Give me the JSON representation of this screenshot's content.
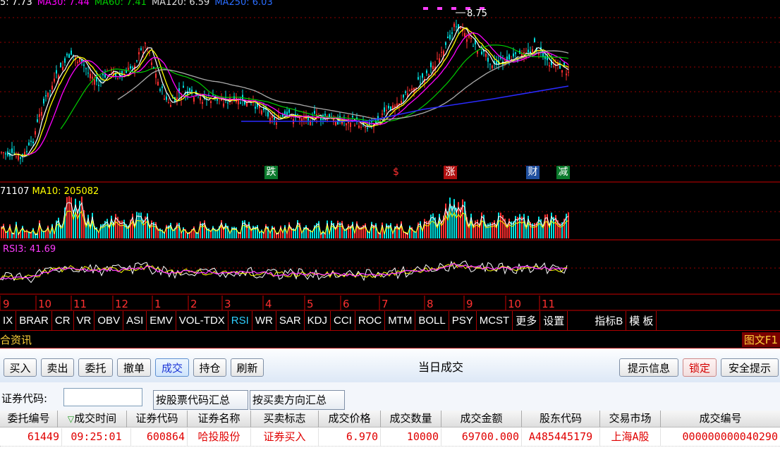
{
  "colors": {
    "ma5": "#ffffff",
    "ma10": "#ffff00",
    "ma20": "#ff00ff",
    "ma60": "#00cc00",
    "ma120": "#aaaaaa",
    "ma250": "#2a2aff",
    "up": "#ff3030",
    "down": "#00e0e0",
    "grid": "#990000"
  },
  "price_panel": {
    "ma_legend": [
      {
        "text": "5: 7.73",
        "color": "#ffffff"
      },
      {
        "text": "MA30: 7.44",
        "color": "#ff00ff"
      },
      {
        "text": "MA60: 7.41",
        "color": "#00cc00"
      },
      {
        "text": "MA120: 6.59",
        "color": "#dddddd"
      },
      {
        "text": "MA250: 6.03",
        "color": "#2a6dff"
      }
    ],
    "high_label": "8.75",
    "markers": [
      {
        "text": "跌",
        "bg": "#0b7a2c"
      },
      {
        "text": "$",
        "bg": "#000000"
      },
      {
        "text": "涨",
        "bg": "#b01010"
      },
      {
        "text": "财",
        "bg": "#1f4f9e"
      },
      {
        "text": "减",
        "bg": "#0b7a2c"
      }
    ]
  },
  "volume_panel": {
    "legend_a": "71107",
    "legend_b": "MA10: 205082"
  },
  "rsi_panel": {
    "legend": "RSI3: 41.69"
  },
  "months": [
    "9",
    "10",
    "11",
    "12",
    "1",
    "2",
    "3",
    "4",
    "5",
    "6",
    "7",
    "8",
    "9",
    "10",
    "11"
  ],
  "indicator_tabs": [
    "IX",
    "BRAR",
    "CR",
    "VR",
    "OBV",
    "ASI",
    "EMV",
    "VOL-TDX",
    "RSI",
    "WR",
    "SAR",
    "KDJ",
    "CCI",
    "ROC",
    "MTM",
    "BOLL",
    "PSY",
    "MCST",
    "更多",
    "设置",
    "指标B",
    "模 板"
  ],
  "active_indicator": "RSI",
  "info_bar": {
    "left": "合资讯",
    "right": "图文F1"
  },
  "toolbar": {
    "buttons": [
      "买入",
      "卖出",
      "委托",
      "撤单",
      "成交",
      "持仓",
      "刷新"
    ],
    "selected": "成交",
    "title": "当日成交",
    "right_buttons": [
      "提示信息",
      "锁定",
      "安全提示"
    ]
  },
  "filter": {
    "label": "证券代码:",
    "input_value": "",
    "btn_by_code": "按股票代码汇总",
    "btn_by_direction": "按买卖方向汇总"
  },
  "table": {
    "sort_icon": "sort-desc-icon",
    "columns": [
      "委托编号",
      "成交时间",
      "证券代码",
      "证券名称",
      "买卖标志",
      "成交价格",
      "成交数量",
      "成交金额",
      "股东代码",
      "交易市场",
      "成交编号"
    ],
    "rows": [
      [
        "61449",
        "09:25:01",
        "600864",
        "哈投股份",
        "证券买入",
        "6.970",
        "10000",
        "69700.000",
        "A485445179",
        "上海A股",
        "000000000040290"
      ]
    ]
  }
}
